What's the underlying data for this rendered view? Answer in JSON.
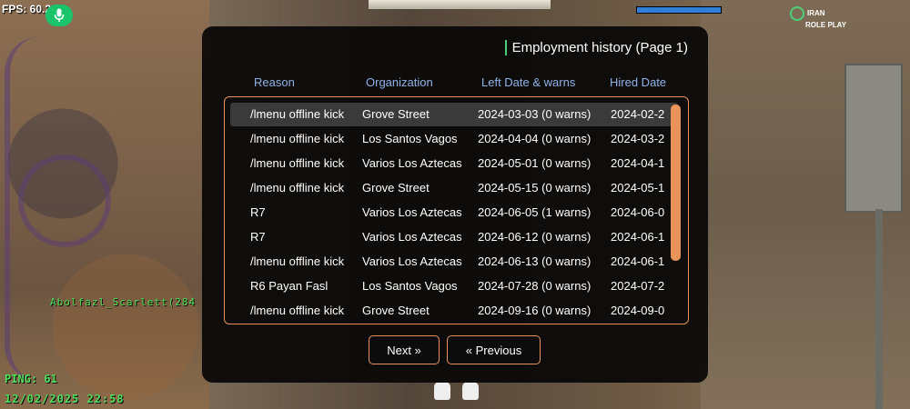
{
  "hud": {
    "fps": "FPS: 60.2",
    "player_tag": "Abolfazl_Scarlett(284",
    "ping": "PING: 61",
    "datetime": "12/02/2025 22:58",
    "health_fraction": 1.0,
    "logo_line1": "IRAN",
    "logo_line2": "ROLE PLAY"
  },
  "dialog": {
    "title": "Employment history (Page 1)",
    "columns": [
      "Reason",
      "Organization",
      "Left Date & warns",
      "Hired Date"
    ],
    "rows": [
      {
        "reason": "/lmenu offline kick",
        "organization": "Grove Street",
        "left": "2024-03-03 (0 warns)",
        "hired": "2024-02-2"
      },
      {
        "reason": "/lmenu offline kick",
        "organization": "Los Santos Vagos",
        "left": "2024-04-04 (0 warns)",
        "hired": "2024-03-2"
      },
      {
        "reason": "/lmenu offline kick",
        "organization": "Varios Los Aztecas",
        "left": "2024-05-01 (0 warns)",
        "hired": "2024-04-1"
      },
      {
        "reason": "/lmenu offline kick",
        "organization": "Grove Street",
        "left": "2024-05-15 (0 warns)",
        "hired": "2024-05-1"
      },
      {
        "reason": "R7",
        "organization": "Varios Los Aztecas",
        "left": "2024-06-05 (1 warns)",
        "hired": "2024-06-0"
      },
      {
        "reason": "R7",
        "organization": "Varios Los Aztecas",
        "left": "2024-06-12 (0 warns)",
        "hired": "2024-06-1"
      },
      {
        "reason": "/lmenu offline kick",
        "organization": "Varios Los Aztecas",
        "left": "2024-06-13 (0 warns)",
        "hired": "2024-06-1"
      },
      {
        "reason": "R6 Payan Fasl",
        "organization": "Los Santos Vagos",
        "left": "2024-07-28 (0 warns)",
        "hired": "2024-07-2"
      },
      {
        "reason": "/lmenu offline kick",
        "organization": "Grove Street",
        "left": "2024-09-16 (0 warns)",
        "hired": "2024-09-0"
      }
    ],
    "selected_index": 0,
    "next_label": "Next »",
    "previous_label": "« Previous"
  },
  "colors": {
    "accent": "#e8935a",
    "header_text": "#8fb3e8",
    "hud_green": "#4de05a",
    "mic": "#19c46b",
    "health": "#2f7fd8"
  }
}
